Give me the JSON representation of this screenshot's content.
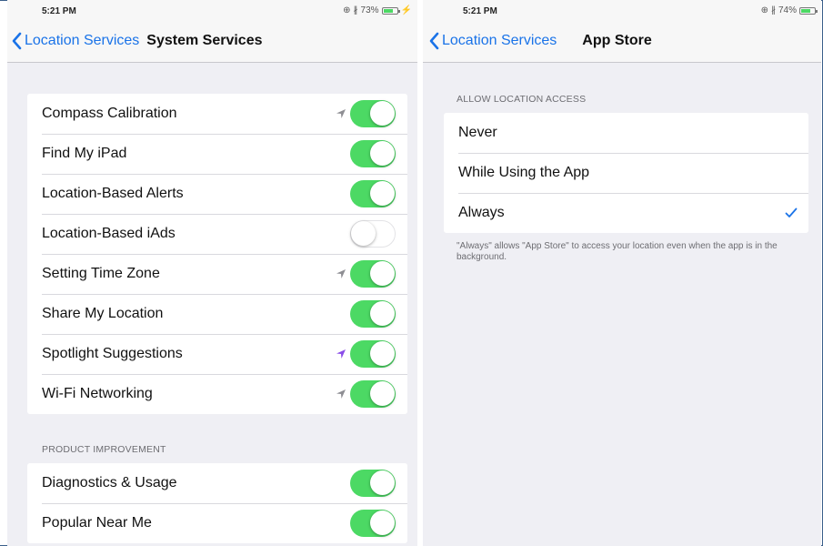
{
  "left": {
    "status": {
      "time": "5:21 PM",
      "battery": "73%",
      "battery_level": 0.73
    },
    "nav": {
      "back_label": "Location Services",
      "title": "System Services"
    },
    "items": [
      {
        "label": "Compass Calibration",
        "arrow": "gray",
        "on": true
      },
      {
        "label": "Find My iPad",
        "arrow": "",
        "on": true
      },
      {
        "label": "Location-Based Alerts",
        "arrow": "",
        "on": true
      },
      {
        "label": "Location-Based iAds",
        "arrow": "",
        "on": false
      },
      {
        "label": "Setting Time Zone",
        "arrow": "gray",
        "on": true
      },
      {
        "label": "Share My Location",
        "arrow": "",
        "on": true
      },
      {
        "label": "Spotlight Suggestions",
        "arrow": "purple",
        "on": true
      },
      {
        "label": "Wi-Fi Networking",
        "arrow": "gray",
        "on": true
      }
    ],
    "section2_header": "PRODUCT IMPROVEMENT",
    "items2": [
      {
        "label": "Diagnostics & Usage",
        "on": true
      },
      {
        "label": "Popular Near Me",
        "on": true
      }
    ]
  },
  "right": {
    "status": {
      "time": "5:21 PM",
      "battery": "74%",
      "battery_level": 0.74
    },
    "nav": {
      "back_label": "Location Services",
      "title": "App Store"
    },
    "section_header": "ALLOW LOCATION ACCESS",
    "options": [
      {
        "label": "Never",
        "selected": false
      },
      {
        "label": "While Using the App",
        "selected": false
      },
      {
        "label": "Always",
        "selected": true
      }
    ],
    "footer": "\"Always\" allows \"App Store\" to access your location even when the app is in the background."
  },
  "colors": {
    "accent": "#1a73e8",
    "toggle_on": "#4cd964",
    "arrow_gray": "#8e8e93",
    "arrow_purple": "#8a4de8"
  }
}
